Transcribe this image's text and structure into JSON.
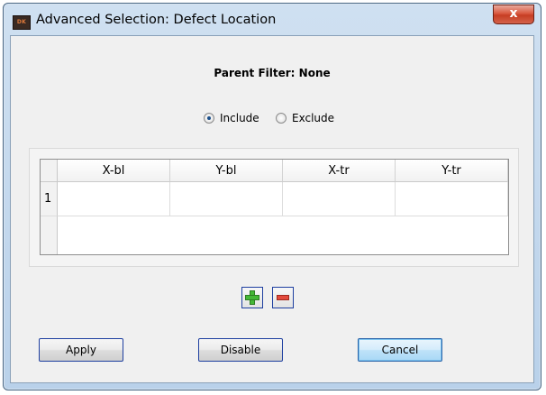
{
  "window": {
    "title": "Advanced Selection: Defect Location",
    "app_icon": "app-logo-icon",
    "app_icon_text": "DK",
    "close_icon": "close-icon",
    "close_glyph": "x"
  },
  "filter": {
    "parent_filter_text": "Parent Filter: None"
  },
  "mode": {
    "options": [
      {
        "label": "Include",
        "selected": true
      },
      {
        "label": "Exclude",
        "selected": false
      }
    ]
  },
  "table": {
    "columns": [
      "X-bl",
      "Y-bl",
      "X-tr",
      "Y-tr"
    ],
    "rows": [
      {
        "index": "1",
        "cells": [
          "",
          "",
          "",
          ""
        ]
      }
    ]
  },
  "row_actions": {
    "add_icon": "plus-icon",
    "remove_icon": "minus-icon"
  },
  "buttons": {
    "apply": "Apply",
    "disable": "Disable",
    "cancel": "Cancel"
  },
  "colors": {
    "titlebar": "#b9d1ea",
    "close_button": "#c63e23",
    "button_border": "#1e3fa0",
    "add_green": "#45b837",
    "remove_red": "#e34a3d"
  }
}
